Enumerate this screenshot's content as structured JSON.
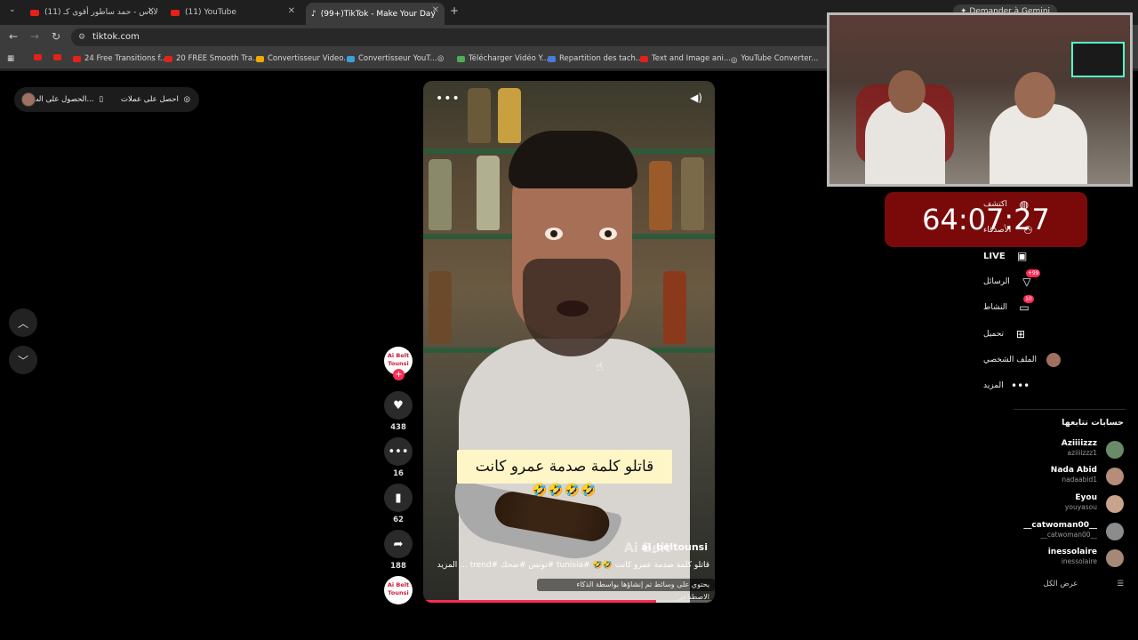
{
  "browser": {
    "tabs": [
      {
        "label": "(11) لاباس - حمد ساطور أقوى كـ"
      },
      {
        "label": "(11) YouTube"
      },
      {
        "label": "(99+)TikTok - Make Your Day"
      }
    ],
    "url": "tiktok.com",
    "gemini_label": "Demander à Gemini",
    "bookmarks": [
      "24 Free Transitions f...",
      "20 FREE Smooth Tra...",
      "Convertisseur Video...",
      "Convertisseur YouT...",
      "Télécharger Vidéo Y...",
      "Repartition des tach...",
      "Text and Image ani...",
      "YouTube Converter..."
    ]
  },
  "top_pill": {
    "get_coins": "احصل على عملات",
    "get_app": "الحصول على الت..."
  },
  "video": {
    "caption": "قاتلو كلمة صدمة عمرو كانت",
    "emojis": "🤣🤣🤣🤣",
    "author": "ai_beltounsi",
    "description": "قاتلو كلمة صدمة عمرو كانت 🤣🤣 #tunisia #تونس #ضحك #trend ... المزيد",
    "ai_notice": "يحتوي على وسائط تم إنشاؤها بواسطة الذكاء الاصطناعي",
    "watermark": "Ai Belt",
    "progress": 0.8
  },
  "actions": {
    "creator_logo": "Ai Belt Tounsi",
    "likes": "438",
    "comments": "16",
    "saves": "62",
    "shares": "188"
  },
  "timer": "64:07:27",
  "right_nav": {
    "items": [
      {
        "label": "اكتشف",
        "icon": "compass-icon"
      },
      {
        "label": "الأصدقاء",
        "icon": "friends-icon"
      },
      {
        "label": "LIVE",
        "icon": "live-icon"
      },
      {
        "label": "الرسائل",
        "icon": "messages-icon",
        "badge": "99+"
      },
      {
        "label": "النشاط",
        "icon": "activity-icon",
        "badge": "10"
      },
      {
        "label": "تحميل",
        "icon": "upload-icon"
      },
      {
        "label": "الملف الشخصي",
        "icon": "profile-icon"
      },
      {
        "label": "المزيد",
        "icon": "more-icon"
      }
    ],
    "following_title": "حسابات تتابعها",
    "following": [
      {
        "name": "Aziiiizzz",
        "handle": "aziiiizzz1",
        "color": "#6a8a6a"
      },
      {
        "name": "Nada Abid",
        "handle": "nadaabid1",
        "color": "#b58d7a"
      },
      {
        "name": "Eyou",
        "handle": "youyasou",
        "color": "#c9a38b"
      },
      {
        "name": "__catwoman00__",
        "handle": "__catwoman00__",
        "color": "#8c8c8c"
      },
      {
        "name": "inessolaire",
        "handle": "inessolaire",
        "color": "#a58876"
      }
    ],
    "see_all": "عرض الكل"
  },
  "colors": {
    "accent": "#fe2c55",
    "timer_bg": "#7a0a0a"
  }
}
